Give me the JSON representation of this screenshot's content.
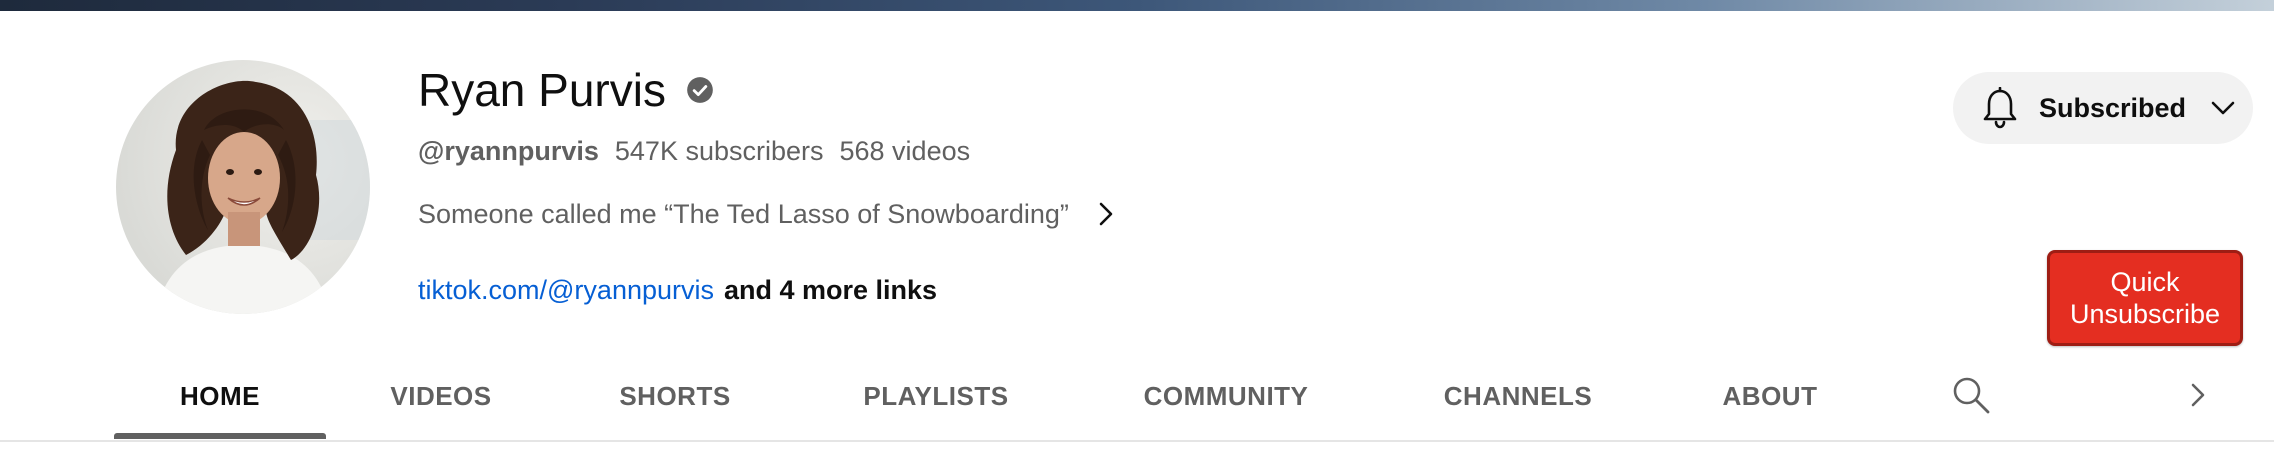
{
  "channel": {
    "name": "Ryan Purvis",
    "handle": "@ryannpurvis",
    "subscribers": "547K subscribers",
    "videos": "568 videos",
    "description": "Someone called me “The Ted Lasso of Snowboarding”",
    "link_url": "tiktok.com/@ryannpurvis",
    "more_links": "and 4 more links"
  },
  "actions": {
    "subscribed_label": "Subscribed",
    "quick_unsubscribe_line1": "Quick",
    "quick_unsubscribe_line2": "Unsubscribe"
  },
  "tabs": [
    {
      "label": "HOME",
      "active": true
    },
    {
      "label": "VIDEOS",
      "active": false
    },
    {
      "label": "SHORTS",
      "active": false
    },
    {
      "label": "PLAYLISTS",
      "active": false
    },
    {
      "label": "COMMUNITY",
      "active": false
    },
    {
      "label": "CHANNELS",
      "active": false
    },
    {
      "label": "ABOUT",
      "active": false
    }
  ],
  "icons": {
    "verified": "verified-check-icon",
    "bell": "bell-icon",
    "chevron_down": "chevron-down-icon",
    "description_more": "chevron-right-icon",
    "search": "search-icon",
    "tabs_next": "chevron-right-icon"
  },
  "colors": {
    "link": "#065fd4",
    "quick_unsubscribe": "#e42e21",
    "subscribed_bg": "#f2f2f2",
    "text_secondary": "#606060"
  }
}
